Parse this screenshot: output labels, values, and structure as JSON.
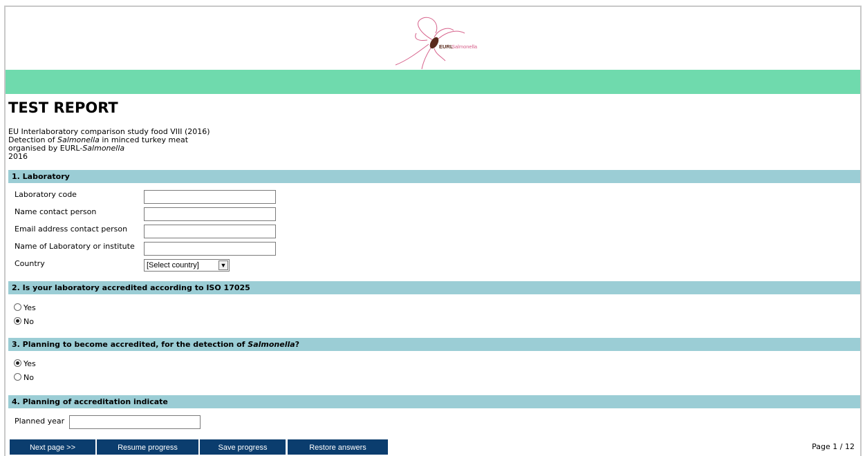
{
  "header": {
    "logo_text_eurl": "EURL",
    "logo_text_salmonella": "Salmonella"
  },
  "colors": {
    "green_band": "#6fdaad",
    "section_bar": "#9bcdd5",
    "button_bg": "#0b3d6e"
  },
  "title": "TEST REPORT",
  "intro": {
    "line1": "EU Interlaboratory comparison study food VIII (2016)",
    "line2_pre": "Detection of ",
    "line2_ital": "Salmonella",
    "line2_post": " in minced turkey meat",
    "line3_pre": "organised by EURL-",
    "line3_ital": "Salmonella",
    "line4": "2016"
  },
  "section1": {
    "heading": "1. Laboratory",
    "fields": [
      {
        "label": "Laboratory code",
        "value": ""
      },
      {
        "label": "Name contact person",
        "value": ""
      },
      {
        "label": "Email address contact person",
        "value": ""
      },
      {
        "label": "Name of Laboratory or institute",
        "value": ""
      }
    ],
    "country_label": "Country",
    "country_value": "[Select country]"
  },
  "section2": {
    "heading": "2. Is your laboratory accredited according to ISO 17025",
    "options": [
      {
        "label": "Yes",
        "checked": false
      },
      {
        "label": "No",
        "checked": true
      }
    ]
  },
  "section3": {
    "heading_pre": "3. Planning to become accredited, for the detection of ",
    "heading_ital": "Salmonella",
    "heading_post": "?",
    "options": [
      {
        "label": "Yes",
        "checked": true
      },
      {
        "label": "No",
        "checked": false
      }
    ]
  },
  "section4": {
    "heading": "4. Planning of accreditation indicate",
    "planned_year_label": "Planned year",
    "planned_year_value": ""
  },
  "buttons": {
    "next": "Next page >>",
    "resume": "Resume progress",
    "save": "Save progress",
    "restore": "Restore answers"
  },
  "page_indicator": "Page 1 / 12"
}
